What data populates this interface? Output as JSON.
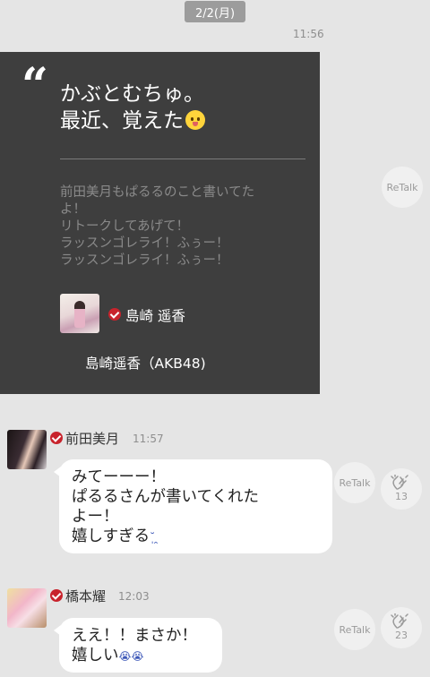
{
  "header": {
    "date": "2/2(月)",
    "time": "11:56"
  },
  "quote_card": {
    "title_line1": "かぶとむちゅ。",
    "title_line2": "最近、覚えた",
    "title_emoji": "smiley-emoji",
    "body_lines": [
      "前田美月もぱるるのこと書いてた",
      "よ！",
      "リトークしてあげて！",
      "ラッスンゴレライ！ふぅー！",
      "ラッスンゴレライ！ふぅー！"
    ],
    "author_name": "島崎 遥香",
    "author_group": "島崎遥香（AKB48)"
  },
  "retalk_label": "ReTalk",
  "messages": [
    {
      "name": "前田美月",
      "time": "11:57",
      "lines": [
        "みてーーー！",
        "ぱるるさんが書いてくれた",
        "よー！",
        "嬉しすぎる"
      ],
      "emoji": "˘̩ ̯",
      "clap_count": "13"
    },
    {
      "name": "橋本耀",
      "time": "12:03",
      "lines": [
        "ええ！！まさか！",
        "嬉しい"
      ],
      "emoji": "😭😭",
      "clap_count": "23"
    }
  ],
  "colors": {
    "verified": "#c8232c",
    "card_bg": "#3e3e3e",
    "screen_bg": "#e5e5e5"
  }
}
